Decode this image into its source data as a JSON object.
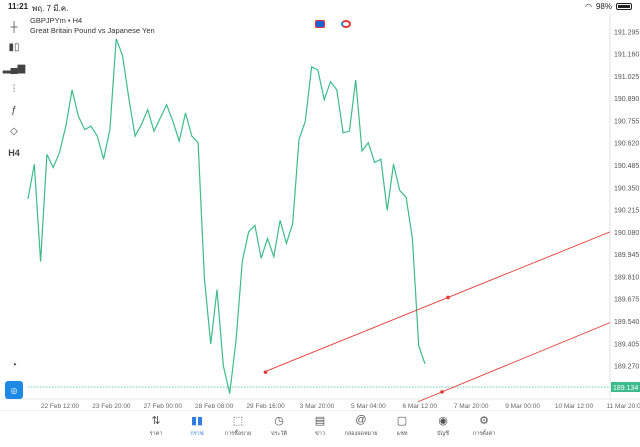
{
  "status": {
    "time": "11:21",
    "date": "พฤ. 7 มี.ค.",
    "battery": "98%"
  },
  "symbol": {
    "name": "GBPJPYm • H4",
    "description": "Great Britain Pound vs Japanese Yen"
  },
  "toolbar": [
    "crosshair-icon",
    "candles-icon",
    "bar-chart-icon",
    "settings-sliders-icon",
    "function-icon",
    "shapes-icon"
  ],
  "timeframe": "H4",
  "colors": {
    "line": "#3dbb8a",
    "trend": "#e53935",
    "price_tag": "#3dbb8a",
    "accent": "#2f7de1"
  },
  "chart_data": {
    "type": "line",
    "ylim": [
      189.134,
      191.4
    ],
    "y_ticks": [
      "191.295",
      "191.160",
      "191.025",
      "190.890",
      "190.755",
      "190.620",
      "190.485",
      "190.350",
      "190.215",
      "190.080",
      "189.945",
      "189.810",
      "189.675",
      "189.540",
      "189.405",
      "189.270"
    ],
    "x_ticks": [
      "22 Feb 12:00",
      "23 Feb 20:00",
      "27 Feb 00:00",
      "28 Feb 08:00",
      "29 Feb 16:00",
      "3 Mar 20:00",
      "5 Mar 04:00",
      "6 Mar 12:00",
      "7 Mar 20:00",
      "9 Mar 00:00",
      "10 Mar 12:00",
      "11 Mar 20:00"
    ],
    "current_price": "189.134",
    "series": [
      {
        "values": [
          190.28,
          190.49,
          189.9,
          190.55,
          190.47,
          190.56,
          190.72,
          190.94,
          190.78,
          190.7,
          190.72,
          190.66,
          190.52,
          190.7,
          191.25,
          191.15,
          190.89,
          190.66,
          190.73,
          190.82,
          190.69,
          190.77,
          190.85,
          190.75,
          190.63,
          190.8,
          190.66,
          190.62,
          189.8,
          189.4,
          189.73,
          189.27,
          189.1,
          189.42,
          189.9,
          190.08,
          190.12,
          189.92,
          190.04,
          189.93,
          190.15,
          190.01,
          190.13,
          190.64,
          190.75,
          191.08,
          191.06,
          190.88,
          190.99,
          190.94,
          190.68,
          190.69,
          191.0,
          190.57,
          190.62,
          190.5,
          190.52,
          190.21,
          190.49,
          190.33,
          190.29,
          190.04,
          189.39,
          189.28
        ]
      }
    ],
    "trendlines": [
      {
        "x1": "29 Feb 16:00",
        "y1": 189.23,
        "x2": "11 Mar 20:00",
        "y2": 190.08
      },
      {
        "x1": "6 Mar 12:00",
        "y1": 189.05,
        "x2": "11 Mar 20:00",
        "y2": 189.53
      }
    ]
  },
  "nav": [
    {
      "label": "ราคา",
      "icon": "quotes-icon"
    },
    {
      "label": "กราฟ",
      "icon": "chart-icon",
      "active": true
    },
    {
      "label": "การซื้อขาย",
      "icon": "trade-icon"
    },
    {
      "label": "ประวัติ",
      "icon": "history-icon"
    },
    {
      "label": "ข่าว",
      "icon": "news-icon"
    },
    {
      "label": "กล่องจดหมาย",
      "icon": "mailbox-icon"
    },
    {
      "label": "แชท",
      "icon": "chat-icon"
    },
    {
      "label": "บัญชี",
      "icon": "account-icon"
    },
    {
      "label": "การตั้งค่า",
      "icon": "settings-icon"
    }
  ]
}
